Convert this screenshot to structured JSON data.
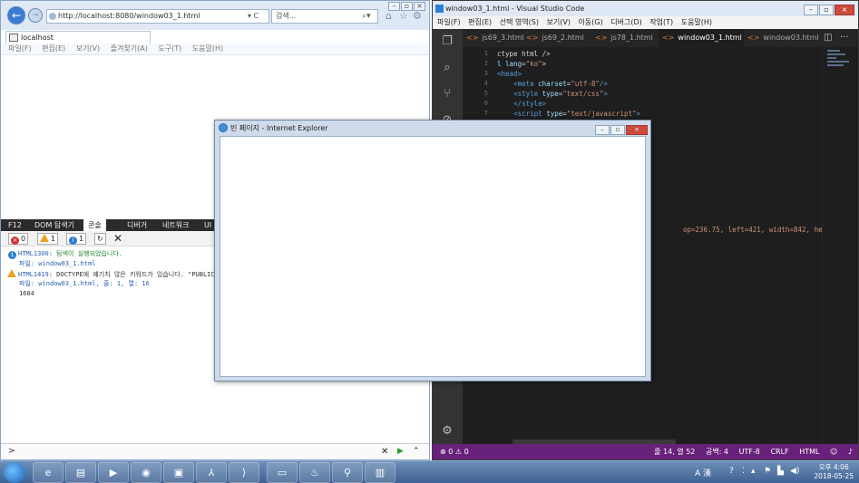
{
  "ie": {
    "url": "http://localhost:8080/window03_1.html",
    "addr_controls": "▾ C",
    "search_placeholder": "검색...",
    "tab_title": "localhost",
    "menu": [
      "파일(F)",
      "편집(E)",
      "보기(V)",
      "즐겨찾기(A)",
      "도구(T)",
      "도움말(H)"
    ],
    "devtools": {
      "tabs": [
        "F12",
        "DOM 탐색기",
        "콘솔",
        "디버거",
        "네트워크",
        "UI"
      ],
      "active_tab": "콘솔",
      "counts": {
        "errors": "0",
        "warnings": "1",
        "info": "1"
      },
      "console": [
        {
          "code": "HTML1300:",
          "text": "탐색이 실행되었습니다."
        },
        {
          "code": "",
          "text": "파일: window03_1.html"
        },
        {
          "code": "HTML1419:",
          "text": "DOCTYPE에 예기치 않은 키워드가 있습니다. \"PUBLIC"
        },
        {
          "code": "",
          "text": "파일: window03_1.html, 줄: 1, 열: 16"
        },
        {
          "code": "",
          "text": "1684"
        }
      ]
    },
    "bottom_prompt": ">"
  },
  "vscode": {
    "title": "window03_1.html - Visual Studio Code",
    "menu": [
      "파일(F)",
      "편집(E)",
      "선택 영역(S)",
      "보기(V)",
      "이동(G)",
      "디버그(D)",
      "작업(T)",
      "도움말(H)"
    ],
    "tabs": [
      "js69_3.html",
      "js69_2.html",
      "js78_1.html",
      "window03_1.html",
      "window03.html"
    ],
    "active_tab": "window03_1.html",
    "line_numbers": [
      "1",
      "2",
      "3",
      "4",
      "5",
      "6",
      "7"
    ],
    "output_text": "op=236.75, left=421, width=842, heigh",
    "status": {
      "errors": "0",
      "warnings": "0",
      "position": "줄 14, 열 52",
      "spaces": "공백: 4",
      "encoding": "UTF-8",
      "eol": "CRLF",
      "language": "HTML"
    }
  },
  "popup": {
    "title": "빈 페이지 - Internet Explorer"
  },
  "taskbar": {
    "clock_time": "오후 4:06",
    "clock_date": "2018-05-25",
    "ime": "A 漢"
  }
}
